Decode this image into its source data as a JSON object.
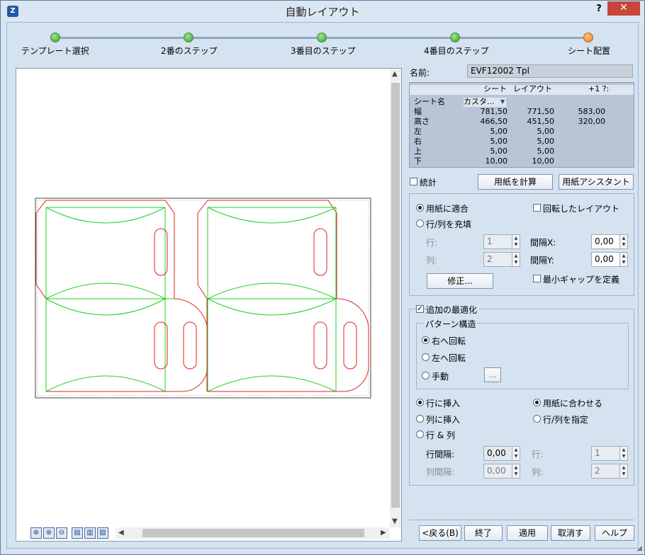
{
  "window": {
    "title": "自動レイアウト",
    "help": "?",
    "close": "✕",
    "icon_letter": "Z"
  },
  "steps": [
    "テンプレート選択",
    "2番のステップ",
    "3番目のステップ",
    "4番目のステップ",
    "シート配置"
  ],
  "name_label": "名前:",
  "name_value": "EVF12002 Tpl",
  "sheet_table": {
    "headers": [
      "シート",
      "レイアウト",
      "+1 ?:"
    ],
    "rows": [
      {
        "label": "シート名",
        "c1": "カスタ...",
        "c2": "",
        "c3": ""
      },
      {
        "label": "幅",
        "c1": "781,50",
        "c2": "771,50",
        "c3": "583,00"
      },
      {
        "label": "高さ",
        "c1": "466,50",
        "c2": "451,50",
        "c3": "320,00"
      },
      {
        "label": "左",
        "c1": "5,00",
        "c2": "5,00",
        "c3": ""
      },
      {
        "label": "右",
        "c1": "5,00",
        "c2": "5,00",
        "c3": ""
      },
      {
        "label": "上",
        "c1": "5,00",
        "c2": "5,00",
        "c3": ""
      },
      {
        "label": "下",
        "c1": "10,00",
        "c2": "10,00",
        "c3": ""
      }
    ]
  },
  "stats_label": "統計",
  "calc_paper_button": "用紙を計算",
  "paper_assistant_button": "用紙アシスタント",
  "layout_group": {
    "fit_paper": "用紙に適合",
    "fill_rows_cols": "行/列を充填",
    "rotated_layout": "回転したレイアウト",
    "row_label": "行:",
    "row_value": "1",
    "col_label": "列:",
    "col_value": "2",
    "gap_x_label": "間隔X:",
    "gap_x_value": "0,00",
    "gap_y_label": "間隔Y:",
    "gap_y_value": "0,00",
    "modify_button": "修正...",
    "min_gap_label": "最小ギャップを定義"
  },
  "optimize_group": {
    "title": "追加の最適化",
    "pattern_title": "パターン構造",
    "rotate_right": "右へ回転",
    "rotate_left": "左へ回転",
    "manual": "手動",
    "manual_button": "...",
    "insert_row": "行に挿入",
    "insert_col": "列に挿入",
    "row_and_col": "行 & 列",
    "fit_paper": "用紙に合わせる",
    "specify_rows_cols": "行/列を指定",
    "row_gap_label": "行間隔:",
    "row_gap_value": "0,00",
    "col_gap_label": "列間隔:",
    "col_gap_value": "0,00",
    "row_label": "行:",
    "row_value": "1",
    "col_label": "列:",
    "col_value": "2"
  },
  "footer_buttons": {
    "back": "<戻る(B)",
    "finish": "終了",
    "apply": "適用",
    "cancel": "取消す",
    "help": "ヘルプ"
  },
  "zoom_tools": [
    "⊕",
    "⊕",
    "⊖",
    "▤",
    "▥",
    "▨"
  ]
}
